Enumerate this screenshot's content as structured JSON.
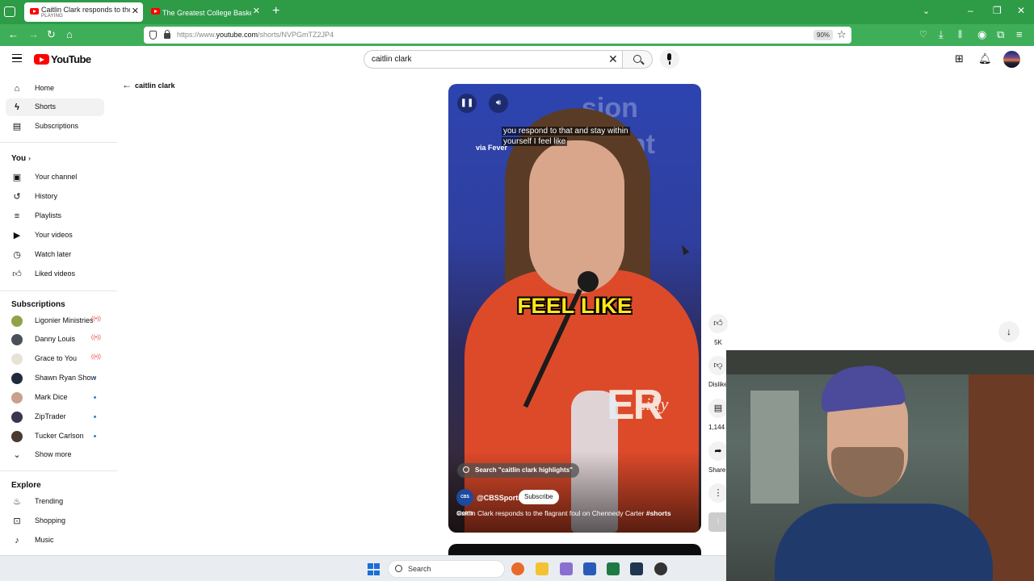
{
  "browser": {
    "tabs": [
      {
        "title": "Caitlin Clark responds to the fla",
        "status": "PLAYING",
        "close": "✕"
      },
      {
        "title": "The Greatest College Basketball",
        "close": "✕"
      }
    ],
    "new_tab": "+",
    "url_prefix": "https://www.",
    "url_domain": "youtube.com",
    "url_path": "/shorts/NVPGmTZ2JP4",
    "zoom": "90%"
  },
  "header": {
    "logo": "YouTube",
    "search_value": "caitlin clark"
  },
  "sidebar": {
    "main": [
      {
        "label": "Home",
        "icon": "home-icon"
      },
      {
        "label": "Shorts",
        "icon": "shorts-icon",
        "selected": true
      },
      {
        "label": "Subscriptions",
        "icon": "subscriptions-icon"
      }
    ],
    "you_heading": "You",
    "you": [
      {
        "label": "Your channel",
        "icon": "channel-icon"
      },
      {
        "label": "History",
        "icon": "history-icon"
      },
      {
        "label": "Playlists",
        "icon": "playlists-icon"
      },
      {
        "label": "Your videos",
        "icon": "your-videos-icon"
      },
      {
        "label": "Watch later",
        "icon": "clock-icon"
      },
      {
        "label": "Liked videos",
        "icon": "thumbs-up-icon"
      }
    ],
    "subscriptions_heading": "Subscriptions",
    "subscriptions": [
      {
        "label": "Ligonier Ministries",
        "indicator": "live",
        "color": "#8fa44a"
      },
      {
        "label": "Danny Louis",
        "indicator": "live",
        "color": "#4a4f5a"
      },
      {
        "label": "Grace to You",
        "indicator": "live",
        "color": "#e8e2d6"
      },
      {
        "label": "Shawn Ryan Show",
        "indicator": "dot",
        "color": "#1f2b3a"
      },
      {
        "label": "Mark Dice",
        "indicator": "dot",
        "color": "#c9a08a"
      },
      {
        "label": "ZipTrader",
        "indicator": "dot",
        "color": "#3b3550"
      },
      {
        "label": "Tucker Carlson",
        "indicator": "dot",
        "color": "#4a3a30"
      }
    ],
    "show_more": "Show more",
    "explore_heading": "Explore",
    "explore": [
      {
        "label": "Trending",
        "icon": "trending-icon"
      },
      {
        "label": "Shopping",
        "icon": "shopping-icon"
      },
      {
        "label": "Music",
        "icon": "music-icon"
      }
    ]
  },
  "shorts": {
    "back_query": "caitlin clark",
    "caption_line1": "you respond to that and stay within",
    "caption_line2": "yourself I feel like",
    "burned_caption": "FEEL LIKE",
    "via_text": "via Fever",
    "search_chip": "Search \"caitlin clark highlights\"",
    "channel_badge": "CBS SPORTS",
    "channel": "@CBSSports",
    "subscribe": "Subscribe",
    "title": "Caitlin Clark responds to the flagrant foul on Chennedy Carter",
    "hashtag": "#shorts",
    "likes": "5K",
    "dislike": "Dislike",
    "comments": "1,144",
    "share": "Share"
  },
  "taskbar": {
    "search": "Search"
  }
}
